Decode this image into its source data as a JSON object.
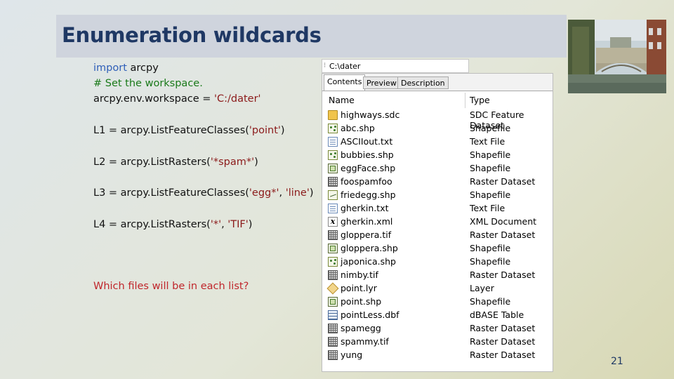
{
  "slide": {
    "title": "Enumeration wildcards",
    "page_number": "21"
  },
  "code": {
    "line1_kw": "import",
    "line1_rest": " arcpy",
    "line2_comment": "# Set the workspace.",
    "line3_prefix": "arcpy.env.workspace = ",
    "line3_str": "'C:/dater'",
    "l1_prefix": "L1 = arcpy.ListFeatureClasses(",
    "l1_str": "'point'",
    "l1_suffix": ")",
    "l2_prefix": "L2 = arcpy.ListRasters(",
    "l2_str": "'*spam*'",
    "l2_suffix": ")",
    "l3_prefix": "L3 = arcpy.ListFeatureClasses(",
    "l3_str1": "'egg*'",
    "l3_mid": ", ",
    "l3_str2": "'line'",
    "l3_suffix": ")",
    "l4_prefix": "L4 = arcpy.ListRasters(",
    "l4_str1": "'*'",
    "l4_mid": ", ",
    "l4_str2": "'TIF'",
    "l4_suffix": ")",
    "question": "Which files will be in each list?"
  },
  "catalog": {
    "address": "C:\\dater",
    "tabs": [
      "Contents",
      "Preview",
      "Description"
    ],
    "columns": {
      "name": "Name",
      "type": "Type"
    },
    "rows": [
      {
        "name": "highways.sdc",
        "type": "SDC Feature Dataset",
        "icon": "folder-icon"
      },
      {
        "name": "abc.shp",
        "type": "Shapefile",
        "icon": "point-shapefile-icon"
      },
      {
        "name": "ASCIIout.txt",
        "type": "Text File",
        "icon": "text-file-icon"
      },
      {
        "name": "bubbies.shp",
        "type": "Shapefile",
        "icon": "point-shapefile-icon"
      },
      {
        "name": "eggFace.shp",
        "type": "Shapefile",
        "icon": "polygon-shapefile-icon"
      },
      {
        "name": "foospamfoo",
        "type": "Raster Dataset",
        "icon": "raster-icon"
      },
      {
        "name": "friedegg.shp",
        "type": "Shapefile",
        "icon": "line-shapefile-icon"
      },
      {
        "name": "gherkin.txt",
        "type": "Text File",
        "icon": "text-file-icon"
      },
      {
        "name": "gherkin.xml",
        "type": "XML Document",
        "icon": "xml-icon"
      },
      {
        "name": "gloppera.tif",
        "type": "Raster Dataset",
        "icon": "raster-icon"
      },
      {
        "name": "gloppera.shp",
        "type": "Shapefile",
        "icon": "polygon-shapefile-icon"
      },
      {
        "name": "japonica.shp",
        "type": "Shapefile",
        "icon": "point-shapefile-icon"
      },
      {
        "name": "nimby.tif",
        "type": "Raster Dataset",
        "icon": "raster-icon"
      },
      {
        "name": "point.lyr",
        "type": "Layer",
        "icon": "layer-icon"
      },
      {
        "name": "point.shp",
        "type": "Shapefile",
        "icon": "polygon-shapefile-icon"
      },
      {
        "name": "pointLess.dbf",
        "type": "dBASE Table",
        "icon": "table-icon"
      },
      {
        "name": "spamegg",
        "type": "Raster Dataset",
        "icon": "raster-icon"
      },
      {
        "name": "spammy.tif",
        "type": "Raster Dataset",
        "icon": "raster-icon"
      },
      {
        "name": "yung",
        "type": "Raster Dataset",
        "icon": "raster-icon"
      }
    ]
  },
  "colors": {
    "title": "#1f3864",
    "keyword": "#2e5eb8",
    "comment": "#1a7a1a",
    "string": "#8b1a1a",
    "question": "#c0262b"
  },
  "photo": {
    "icon": "bridge-photo-icon"
  }
}
